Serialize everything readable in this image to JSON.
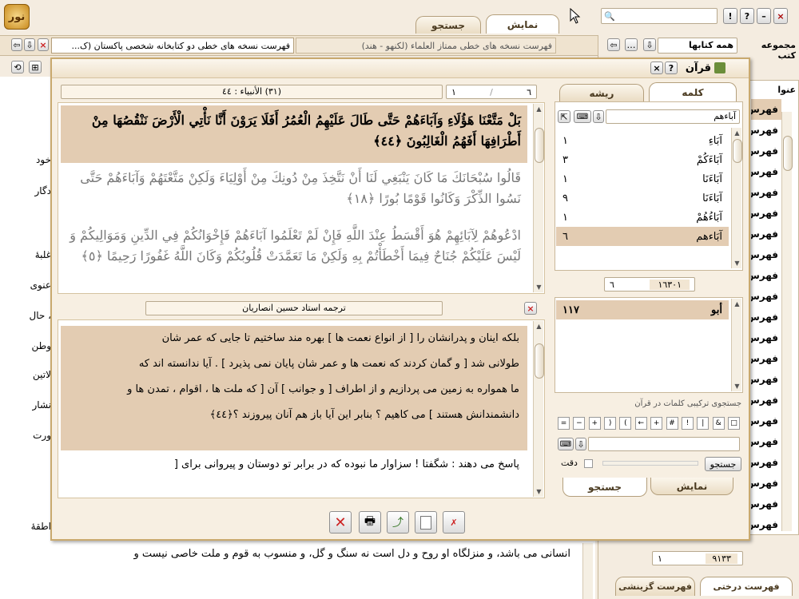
{
  "colors": {
    "accent": "#f2e6d3",
    "highlight": "#e3ccb2",
    "border": "#b49f7c",
    "blue_word": "#3a3ae0",
    "red_icon": "#cc2222"
  },
  "top_tabs": [
    {
      "label": "نمایش"
    },
    {
      "label": "جستجو"
    }
  ],
  "window_buttons": {
    "minimize": "–",
    "maximize": "□",
    "close": "×",
    "help": "?",
    "info": "!"
  },
  "search": {
    "value": "",
    "placeholder": ""
  },
  "collections": {
    "label": "مجموعه کتب",
    "value": "همه کتابها"
  },
  "doc_tabs": {
    "active": "فهرست نسخه های خطی دو کتابخانه شخصی پاکستان (ک...",
    "inactive": "فهرست نسخه های خطی ممتاز العلماء (لکنهو - هند)"
  },
  "right_list": {
    "header": "عنوا",
    "items": [
      "فهرس",
      "فهرس",
      "فهرس",
      "فهرس",
      "فهرس",
      "فهرس",
      "فهرس",
      "فهرس",
      "فهرس",
      "فهرس",
      "فهرس",
      "فهرس",
      "فهرس",
      "فهرس",
      "فهرس",
      "فهرس",
      "فهرس",
      "فهرس",
      "فهرس",
      "فهرس",
      "فهرس",
      "فهرس",
      "فهرس"
    ],
    "page_value": "۹۱۳۳",
    "page_index": "۱",
    "bottom_tabs": [
      "فهرست درختی",
      "فهرست گزینشی"
    ]
  },
  "left_bg": {
    "lines": [
      "خود",
      "دگار",
      "غلبهٔ",
      "عنوی",
      "، حال",
      "وطن",
      "لاتین",
      "نشار",
      "ورت",
      "اطقهٔ"
    ],
    "bottom": "انسانی می باشد، و منزلگاه او روح و دل است نه سنگ و گل، و منسوب به قوم و ملت خاصی نیست و"
  },
  "quran": {
    "title": "قرآن",
    "location": "(۳۱) الأنبیاء : ٤٤",
    "verse_from": "٦",
    "verse_to": "۱",
    "verses": [
      {
        "lines": [
          "بَلْ مَتَّعْنَا هَؤُلَاءِ وَآبَاءَهُمْ حَتَّى طَالَ عَلَيْهِمُ الْعُمُرُ أَفَلَا يَرَوْنَ أَنَّا نَأْتِي الْأَرْضَ نَنْقُصُهَا مِنْ",
          "أَطْرَافِهَا أَفَهُمُ الْغَالِبُونَ ﴿٤٤﴾"
        ],
        "highlight": true
      },
      {
        "lines": [
          "قَالُوا سُبْحَانَكَ مَا كَانَ يَنْبَغِي لَنَا أَنْ نَتَّخِذَ مِنْ دُونِكَ مِنْ أَوْلِيَاءَ وَلَكِنْ مَتَّعْتَهُمْ وَآبَاءَهُمْ حَتَّى",
          "نَسُوا الذِّكْرَ وَكَانُوا قَوْمًا بُورًا ﴿١٨﴾"
        ],
        "highlight": false
      },
      {
        "lines": [
          "ادْعُوهُمْ لِآبَائِهِمْ هُوَ أَقْسَطُ عِنْدَ اللَّهِ فَإِنْ لَمْ تَعْلَمُوا آبَاءَهُمْ فَإِخْوَانُكُمْ فِي الدِّينِ وَمَوَالِيكُمْ وَ",
          "لَيْسَ عَلَيْكُمْ جُنَاحٌ فِيمَا أَخْطَأْتُمْ بِهِ وَلَكِنْ مَا تَعَمَّدَتْ قُلُوبُكُمْ وَكَانَ اللَّهُ غَفُورًا رَحِيمًا ﴿٥﴾"
        ],
        "highlight": false
      }
    ],
    "translation_title": "ترجمه استاد حسین انصاریان",
    "translation": [
      "بلکه اینان و پدرانشان را [ از انواع نعمت ها ] بهره مند ساختیم تا جایی که عمر شان",
      "طولانی شد [ و گمان کردند که نعمت ها و عمر شان پایان نمی پذیرد ] . آیا ندانسته اند که",
      "ما همواره به زمین می پردازیم و از اطراف [ و جوانب ] آن [ که ملت ها ، اقوام ، تمدن ها و",
      "دانشمندانش هستند ] می کاهیم ؟ بنابر این آیا باز هم آنان پیروزند ؟﴿٤٤﴾",
      "پاسخ می دهند : شگفتا ! سزاوار ما نبوده که در برابر تو دوستان و پیروانی برای ["
    ],
    "side_tabs": [
      {
        "label": "کلمه"
      },
      {
        "label": "ریشه"
      }
    ],
    "word_search": "آباءهم",
    "words": [
      {
        "word": "آبَاءِ",
        "count": "۱"
      },
      {
        "word": "آبَاءَكُمْ",
        "count": "۳"
      },
      {
        "word": "آبَاءَنَا",
        "count": "۱"
      },
      {
        "word": "آبَاءَنَا",
        "count": "۹"
      },
      {
        "word": "آبَاءُهُمْ",
        "count": "۱"
      },
      {
        "word": "آبَاءهم",
        "count": "٦"
      }
    ],
    "counter_total": "۱٦۳۰۱",
    "counter_val": "٦",
    "root_word": "أبو",
    "root_count": "۱۱۷",
    "combo_title": "جستجوی ترکیبی کلمات در قرآن",
    "ops": [
      "□",
      "&",
      "|",
      "!",
      "#",
      "+",
      "←",
      "(",
      ")",
      "+",
      "−",
      "="
    ],
    "search_btn": "جستجو",
    "precision": "دقت",
    "bottom_tabs": [
      {
        "label": "نمایش"
      },
      {
        "label": "جستجو"
      }
    ]
  }
}
